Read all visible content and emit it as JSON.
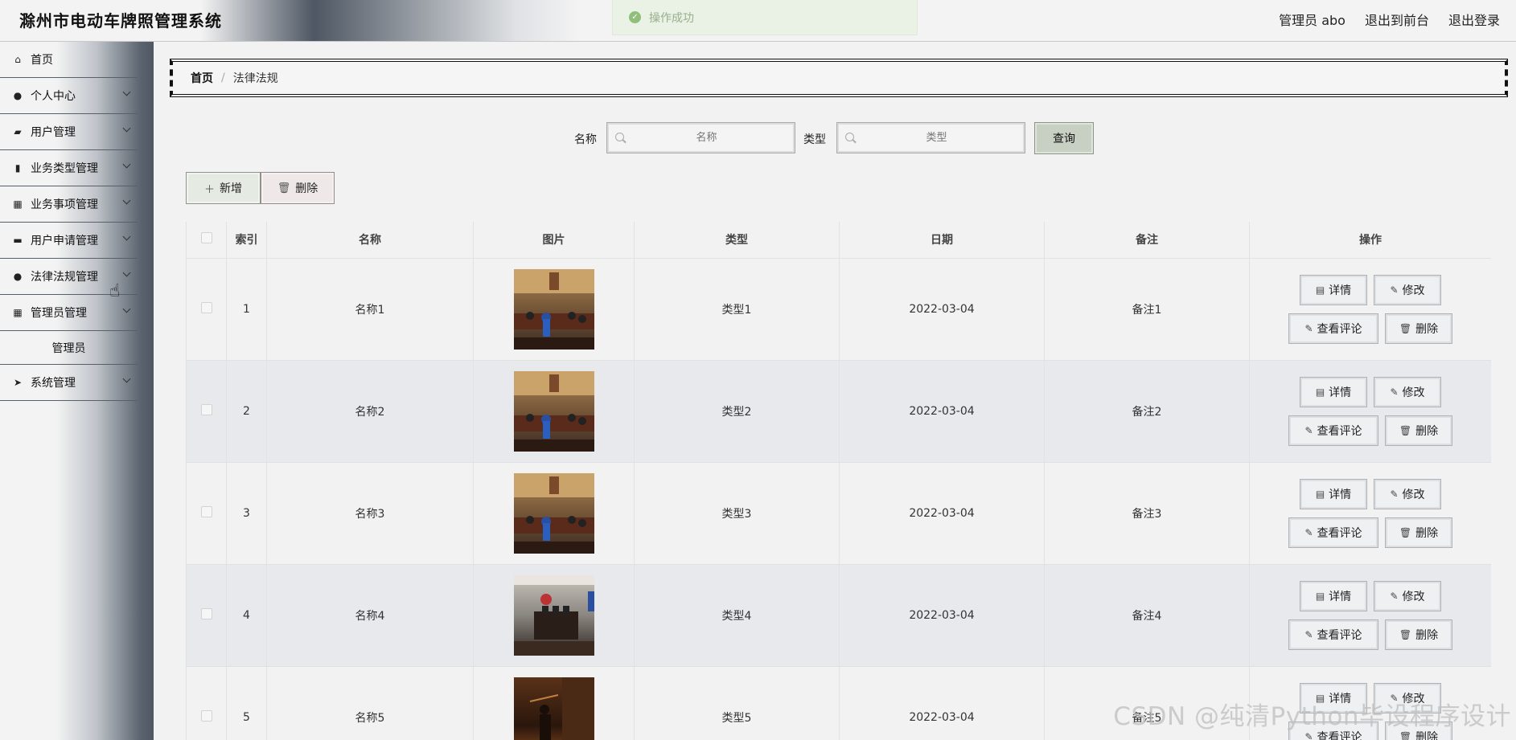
{
  "app": {
    "title": "滁州市电动车牌照管理系统"
  },
  "toast": {
    "message": "操作成功"
  },
  "header": {
    "user_label": "管理员 abo",
    "back_front": "退出到前台",
    "logout": "退出登录"
  },
  "sidebar": {
    "items": [
      {
        "label": "首页",
        "icon": "home-icon",
        "has_children": false
      },
      {
        "label": "个人中心",
        "icon": "user-icon",
        "has_children": true
      },
      {
        "label": "用户管理",
        "icon": "user-group-icon",
        "has_children": true
      },
      {
        "label": "业务类型管理",
        "icon": "bar-chart-icon",
        "has_children": true
      },
      {
        "label": "业务事项管理",
        "icon": "grid-icon",
        "has_children": true
      },
      {
        "label": "用户申请管理",
        "icon": "briefcase-icon",
        "has_children": true
      },
      {
        "label": "法律法规管理",
        "icon": "bulb-icon",
        "has_children": true
      },
      {
        "label": "管理员管理",
        "icon": "grid-icon",
        "has_children": true,
        "sub": [
          "管理员"
        ]
      },
      {
        "label": "系统管理",
        "icon": "send-icon",
        "has_children": true
      }
    ]
  },
  "breadcrumb": {
    "home": "首页",
    "separator": "/",
    "current": "法律法规"
  },
  "search": {
    "name_label": "名称",
    "name_placeholder": "名称",
    "type_label": "类型",
    "type_placeholder": "类型",
    "query_button": "查询"
  },
  "toolbar": {
    "add_label": "新增",
    "delete_label": "删除"
  },
  "table": {
    "columns": [
      "索引",
      "名称",
      "图片",
      "类型",
      "日期",
      "备注",
      "操作"
    ],
    "actions": {
      "detail": "详情",
      "edit": "修改",
      "comments": "查看评论",
      "delete": "删除"
    },
    "rows": [
      {
        "index": "1",
        "name": "名称1",
        "type": "类型1",
        "date": "2022-03-04",
        "note": "备注1",
        "image": "courtroom-photo"
      },
      {
        "index": "2",
        "name": "名称2",
        "type": "类型2",
        "date": "2022-03-04",
        "note": "备注2",
        "image": "courtroom-photo"
      },
      {
        "index": "3",
        "name": "名称3",
        "type": "类型3",
        "date": "2022-03-04",
        "note": "备注3",
        "image": "courtroom-photo"
      },
      {
        "index": "4",
        "name": "名称4",
        "type": "类型4",
        "date": "2022-03-04",
        "note": "备注4",
        "image": "courtroom-bench-photo"
      },
      {
        "index": "5",
        "name": "名称5",
        "type": "类型5",
        "date": "2022-03-04",
        "note": "备注5",
        "image": "justice-statue-photo"
      }
    ]
  },
  "watermark": "CSDN @纯清Python毕设程序设计"
}
